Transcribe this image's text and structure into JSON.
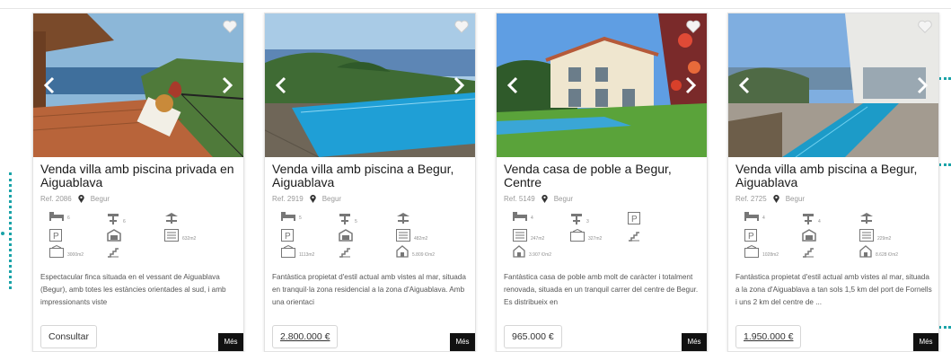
{
  "cards": [
    {
      "title": "Venda villa amb piscina privada en Aiguablava",
      "ref": "Ref. 2086",
      "location": "Begur",
      "features": {
        "bedrooms": "6",
        "bathrooms": "6",
        "built_area": "632m2",
        "plot_area": "3000m2",
        "price_m2": ""
      },
      "description": "Espectacular finca situada en el vessant de Aiguablava (Begur), amb totes les estàncies orientades al sud, i amb impressionants viste",
      "price": "Consultar",
      "more": "Més"
    },
    {
      "title": "Venda villa amb piscina a Begur, Aiguablava",
      "ref": "Ref. 2919",
      "location": "Begur",
      "features": {
        "bedrooms": "5",
        "bathrooms": "5",
        "built_area": "482m2",
        "plot_area": "1113m2",
        "price_m2": "5.809 €/m2"
      },
      "description": "Fantàstica propietat d'estil actual amb vistes al mar, situada en tranquil·la zona residencial a la zona d'Aiguablava. Amb una orientaci",
      "price": "2.800.000 €",
      "more": "Més"
    },
    {
      "title": "Venda casa de poble a Begur, Centre",
      "ref": "Ref. 5149",
      "location": "Begur",
      "features": {
        "bedrooms": "4",
        "bathrooms": "3",
        "built_area": "247m2",
        "plot_area": "327m2",
        "price_m2": "3.907 €/m2"
      },
      "description": "Fantàstica casa de poble amb molt de caràcter i totalment renovada, situada en un tranquil carrer del centre de Begur. Es distribueix en",
      "price": "965.000 €",
      "more": "Més"
    },
    {
      "title": "Venda villa amb piscina a Begur, Aiguablava",
      "ref": "Ref. 2725",
      "location": "Begur",
      "features": {
        "bedrooms": "4",
        "bathrooms": "4",
        "built_area": "229m2",
        "plot_area": "1028m2",
        "price_m2": "8.628 €/m2"
      },
      "description": "Fantàstica propietat d'estil actual amb vistes al mar, situada a la zona d'Aiguablava a tan sols 1,5 km del port de Fornells i uns 2 km del centre de ...",
      "price": "1.950.000 €",
      "more": "Més"
    }
  ],
  "icons": {
    "favorite": "heart-icon",
    "prev": "chevron-left-icon",
    "next": "chevron-right-icon",
    "location": "map-pin-icon",
    "bedrooms": "bed-icon",
    "bathrooms": "shower-icon",
    "terrace": "terrace-icon",
    "parking": "parking-icon",
    "garage": "garage-icon",
    "built_area": "floorplan-icon",
    "plot_area": "plot-icon",
    "stairs": "stairs-icon",
    "price_m2": "house-price-icon"
  },
  "colors": {
    "accent_dots": "#1aa3a8",
    "more_button": "#111111"
  }
}
